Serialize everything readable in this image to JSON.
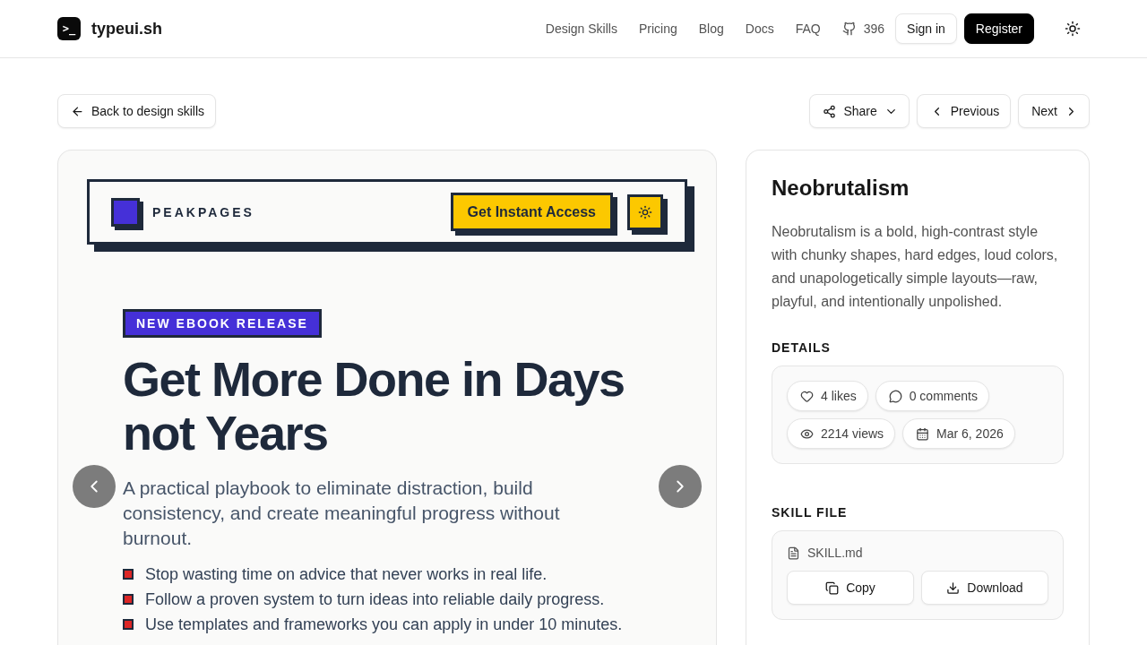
{
  "header": {
    "logo_mark": ">_",
    "brand": "typeui.sh",
    "nav": [
      {
        "label": "Design Skills"
      },
      {
        "label": "Pricing"
      },
      {
        "label": "Blog"
      },
      {
        "label": "Docs"
      },
      {
        "label": "FAQ"
      }
    ],
    "github_stars": "396",
    "sign_in": "Sign in",
    "register": "Register"
  },
  "toolbar": {
    "back": "Back to design skills",
    "share": "Share",
    "previous": "Previous",
    "next": "Next"
  },
  "preview": {
    "brand": "PEAKPAGES",
    "cta": "Get Instant Access",
    "badge": "NEW EBOOK RELEASE",
    "headline": "Get More Done in Days not Years",
    "subhead": "A practical playbook to eliminate distraction, build consistency, and create meaningful progress without burnout.",
    "bullets": [
      "Stop wasting time on advice that never works in real life.",
      "Follow a proven system to turn ideas into reliable daily progress.",
      "Use templates and frameworks you can apply in under 10 minutes."
    ]
  },
  "skill": {
    "title": "Neobrutalism",
    "description": "Neobrutalism is a bold, high-contrast style with chunky shapes, hard edges, loud colors, and unapologetically simple layouts—raw, playful, and intentionally unpolished.",
    "details_heading": "DETAILS",
    "details": [
      {
        "kind": "likes",
        "label": "4 likes"
      },
      {
        "kind": "comments",
        "label": "0 comments"
      },
      {
        "kind": "views",
        "label": "2214 views"
      },
      {
        "kind": "date",
        "label": "Mar 6, 2026"
      }
    ],
    "file_heading": "SKILL FILE",
    "file_name": "SKILL.md",
    "copy": "Copy",
    "download": "Download"
  }
}
